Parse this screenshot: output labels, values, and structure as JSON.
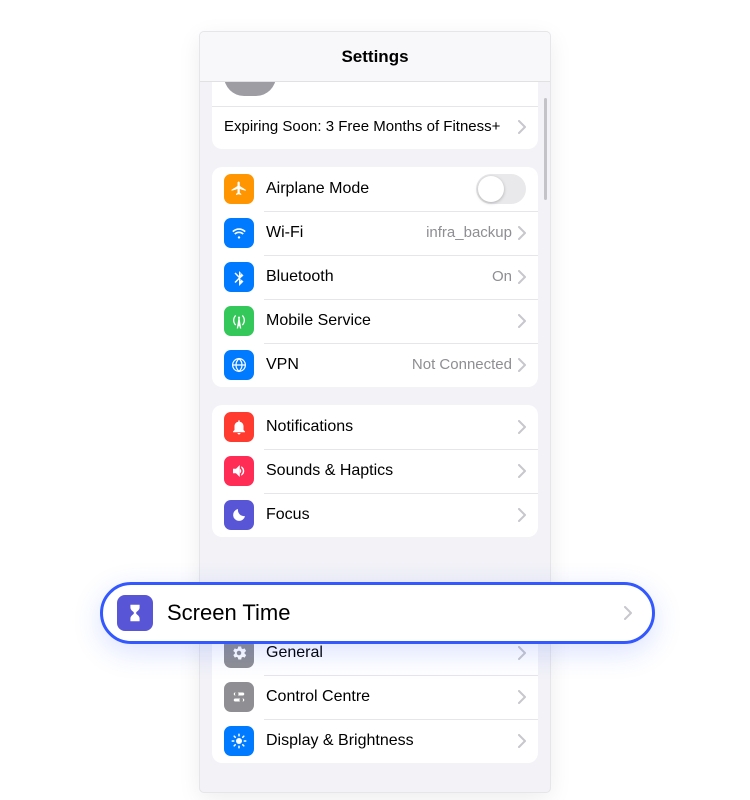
{
  "navbar": {
    "title": "Settings"
  },
  "promo": {
    "text": "Expiring Soon: 3 Free Months of Fitness+"
  },
  "group_conn": {
    "airplane": {
      "label": "Airplane Mode",
      "color": "#ff9500"
    },
    "wifi": {
      "label": "Wi-Fi",
      "value": "infra_backup",
      "color": "#007aff"
    },
    "bluetooth": {
      "label": "Bluetooth",
      "value": "On",
      "color": "#007aff"
    },
    "mobile": {
      "label": "Mobile Service",
      "color": "#34c759"
    },
    "vpn": {
      "label": "VPN",
      "value": "Not Connected",
      "color": "#007aff"
    }
  },
  "group_notify": {
    "notifications": {
      "label": "Notifications",
      "color": "#ff3b30"
    },
    "sounds": {
      "label": "Sounds & Haptics",
      "color": "#ff2d55"
    },
    "focus": {
      "label": "Focus",
      "color": "#5856d6"
    },
    "screentime": {
      "label": "Screen Time",
      "color": "#5856d6"
    }
  },
  "group_general": {
    "general": {
      "label": "General",
      "color": "#8e8e93"
    },
    "control": {
      "label": "Control Centre",
      "color": "#8e8e93"
    },
    "display": {
      "label": "Display & Brightness",
      "color": "#007aff"
    }
  }
}
